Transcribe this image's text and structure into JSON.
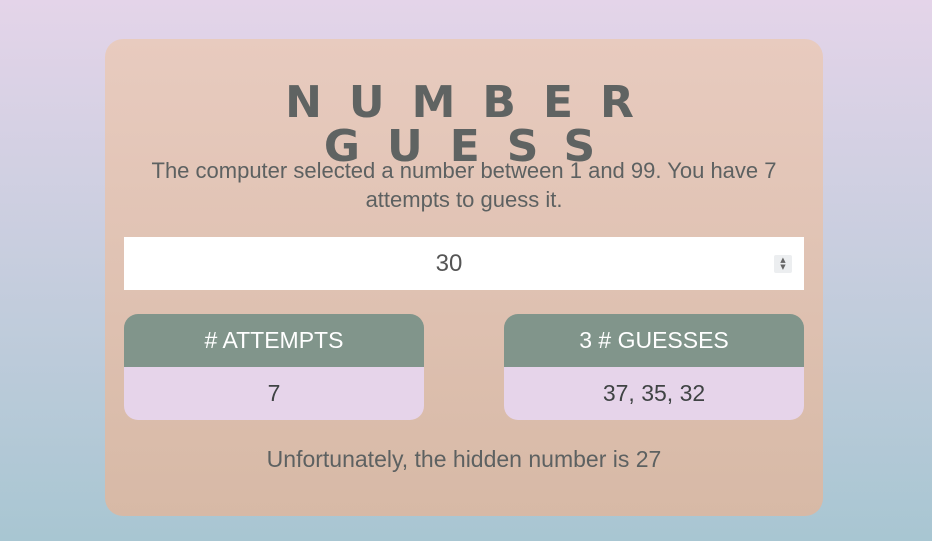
{
  "app": {
    "title": "NUMBER GUESS",
    "description": "The computer selected a number between 1 and 99. You have 7 attempts to guess it."
  },
  "guess_input": {
    "value": "30"
  },
  "attempts_panel": {
    "header": "# ATTEMPTS",
    "value": "7"
  },
  "guesses_panel": {
    "header": "3 # GUESSES",
    "value": "37, 35, 32"
  },
  "result": {
    "message": "Unfortunately, the hidden number is 27"
  },
  "colors": {
    "card_background": "#e8cbbf",
    "panel_header": "#81958b",
    "panel_body": "#e6d4ea",
    "title_text": "#5f6362"
  },
  "icons": {
    "stepper": "spin-stepper-icon"
  }
}
